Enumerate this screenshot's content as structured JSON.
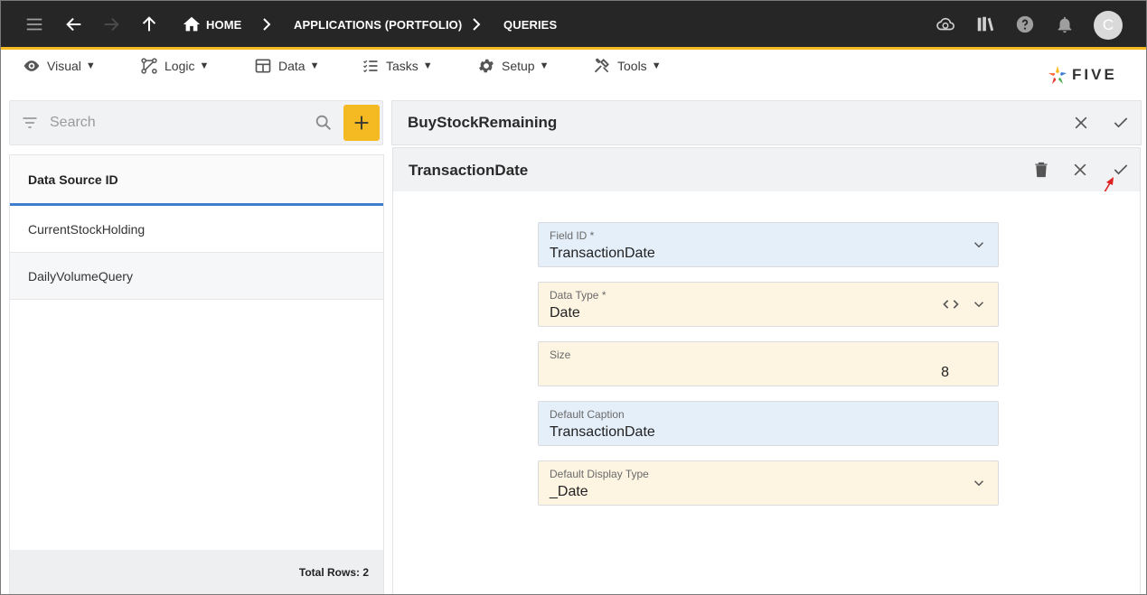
{
  "topbar": {
    "breadcrumbs": [
      "HOME",
      "APPLICATIONS (PORTFOLIO)",
      "QUERIES"
    ],
    "avatar_letter": "C"
  },
  "menubar": {
    "items": [
      {
        "label": "Visual",
        "icon": "eye-icon"
      },
      {
        "label": "Logic",
        "icon": "logic-icon"
      },
      {
        "label": "Data",
        "icon": "table-icon"
      },
      {
        "label": "Tasks",
        "icon": "checklist-icon"
      },
      {
        "label": "Setup",
        "icon": "gear-icon"
      },
      {
        "label": "Tools",
        "icon": "tools-icon"
      }
    ],
    "caret": "▼",
    "logo_text": "FIVE"
  },
  "left": {
    "search_placeholder": "Search",
    "column_header": "Data Source ID",
    "rows": [
      "CurrentStockHolding",
      "DailyVolumeQuery"
    ],
    "footer": "Total Rows: 2"
  },
  "right": {
    "parent_title": "BuyStockRemaining",
    "form_title": "TransactionDate",
    "fields": [
      {
        "label": "Field ID *",
        "value": "TransactionDate"
      },
      {
        "label": "Data Type *",
        "value": "Date"
      },
      {
        "label": "Size",
        "value": "8"
      },
      {
        "label": "Default Caption",
        "value": "TransactionDate"
      },
      {
        "label": "Default Display Type",
        "value": "_Date"
      }
    ]
  },
  "colors": {
    "topbar": "#262626",
    "accent": "#f5b922",
    "selected_underline": "#3f7ecf",
    "field_blue": "#e5effa",
    "field_cream": "#fdf4e2"
  }
}
